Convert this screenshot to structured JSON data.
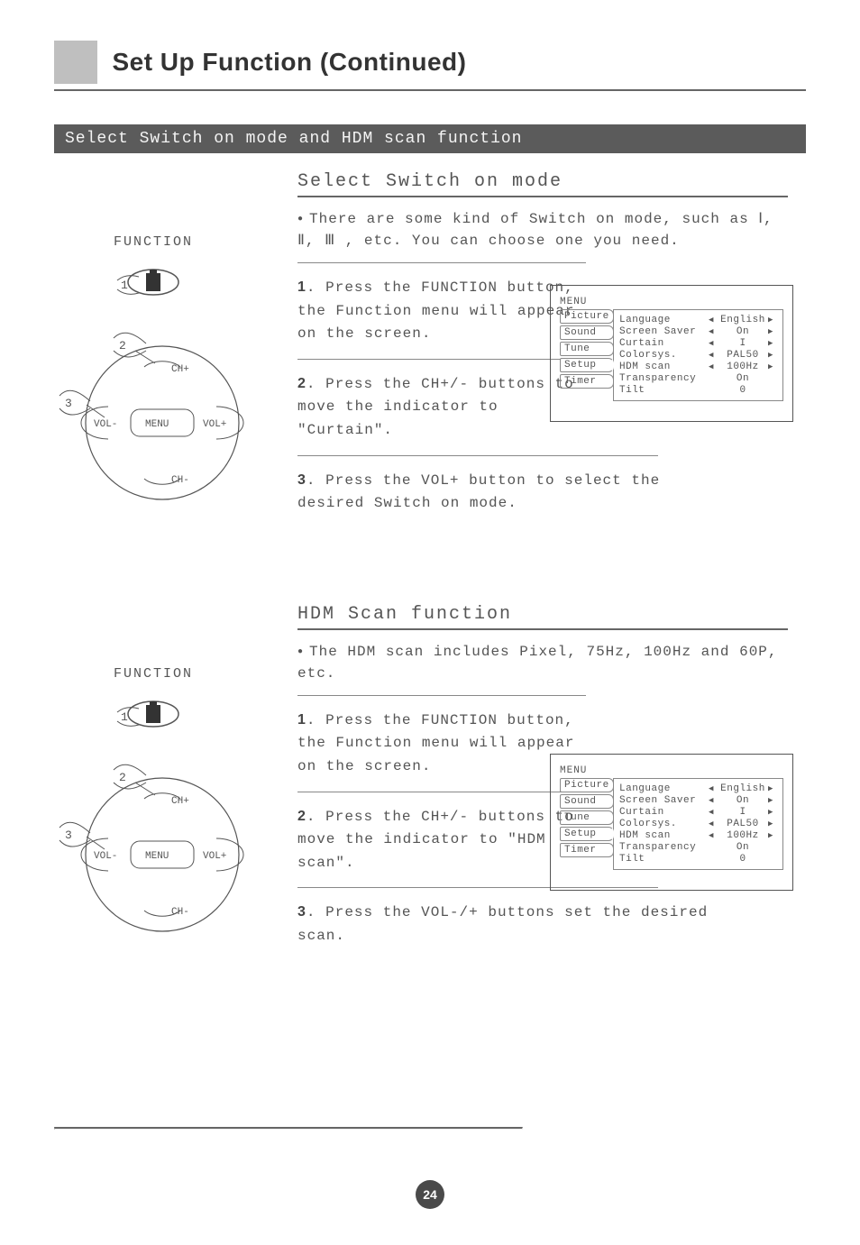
{
  "page": {
    "title": "Set Up Function (Continued)",
    "band": "Select Switch on mode and HDM scan function",
    "number": "24"
  },
  "section1": {
    "title": "Select Switch on mode",
    "bullet": "There are some kind of Switch on mode, such as  Ⅰ, Ⅱ, Ⅲ , etc. You can choose one you need.",
    "steps": [
      {
        "num": "1",
        "text": ". Press the FUNCTION button, the Function menu will appear on the screen."
      },
      {
        "num": "2",
        "text": ". Press the CH+/- buttons to move the indicator to \"Curtain\"."
      },
      {
        "num": "3",
        "text": ". Press the VOL+ button to select the desired Switch on mode."
      }
    ]
  },
  "section2": {
    "title": "HDM Scan function",
    "bullet": "The HDM scan includes Pixel, 75Hz, 100Hz and 60P, etc.",
    "steps": [
      {
        "num": "1",
        "text": ". Press the FUNCTION button, the Function menu will appear on the screen."
      },
      {
        "num": "2",
        "text": ". Press the CH+/- buttons to move the indicator to \"HDM scan\"."
      },
      {
        "num": "3",
        "text": ". Press the VOL-/+ buttons set the desired scan."
      }
    ]
  },
  "osd": {
    "header": "MENU",
    "tabs": [
      "Picture",
      "Sound",
      "Tune",
      "Setup",
      "Timer"
    ],
    "items": [
      {
        "label": "Language",
        "value": "English",
        "left": true,
        "right": true
      },
      {
        "label": "Screen Saver",
        "value": "On",
        "left": true,
        "right": true
      },
      {
        "label": "Curtain",
        "value": "I",
        "left": true,
        "right": true
      },
      {
        "label": "Colorsys.",
        "value": "PAL50",
        "left": true,
        "right": true
      },
      {
        "label": "HDM scan",
        "value": "100Hz",
        "left": true,
        "right": true
      },
      {
        "label": "Transparency",
        "value": "On",
        "left": false,
        "right": false
      },
      {
        "label": "Tilt",
        "value": "0",
        "left": false,
        "right": false
      }
    ]
  },
  "remote": {
    "function_label": "FUNCTION",
    "btn_menu": "MENU",
    "btn_volminus": "VOL-",
    "btn_volplus": "VOL+",
    "btn_chplus": "CH+",
    "btn_chminus": "CH-",
    "callout1": "1",
    "callout2": "2",
    "callout3": "3"
  }
}
